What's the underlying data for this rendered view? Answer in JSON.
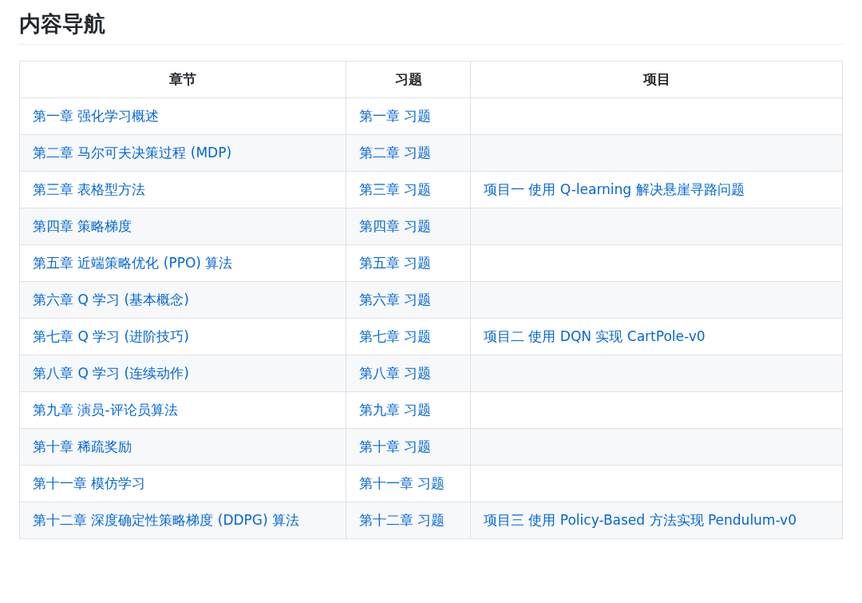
{
  "heading": "内容导航",
  "table": {
    "columns": [
      "章节",
      "习题",
      "项目"
    ],
    "rows": [
      {
        "chapter": "第一章 强化学习概述",
        "exercise": "第一章 习题"
      },
      {
        "chapter": "第二章 马尔可夫决策过程 (MDP)",
        "exercise": "第二章 习题"
      },
      {
        "chapter": "第三章 表格型方法",
        "exercise": "第三章 习题",
        "project": "项目一 使用 Q-learning 解决悬崖寻路问题"
      },
      {
        "chapter": "第四章 策略梯度",
        "exercise": "第四章 习题"
      },
      {
        "chapter": "第五章 近端策略优化 (PPO) 算法",
        "exercise": "第五章 习题"
      },
      {
        "chapter": "第六章 Q 学习 (基本概念)",
        "exercise": "第六章 习题"
      },
      {
        "chapter": "第七章 Q 学习 (进阶技巧)",
        "exercise": "第七章 习题",
        "project": "项目二 使用 DQN 实现 CartPole-v0"
      },
      {
        "chapter": "第八章 Q 学习 (连续动作)",
        "exercise": "第八章 习题"
      },
      {
        "chapter": "第九章 演员-评论员算法",
        "exercise": "第九章 习题"
      },
      {
        "chapter": "第十章 稀疏奖励",
        "exercise": "第十章 习题"
      },
      {
        "chapter": "第十一章 模仿学习",
        "exercise": "第十一章 习题"
      },
      {
        "chapter": "第十二章 深度确定性策略梯度 (DDPG) 算法",
        "exercise": "第十二章 习题",
        "project": "项目三 使用 Policy-Based 方法实现 Pendulum-v0"
      }
    ]
  }
}
